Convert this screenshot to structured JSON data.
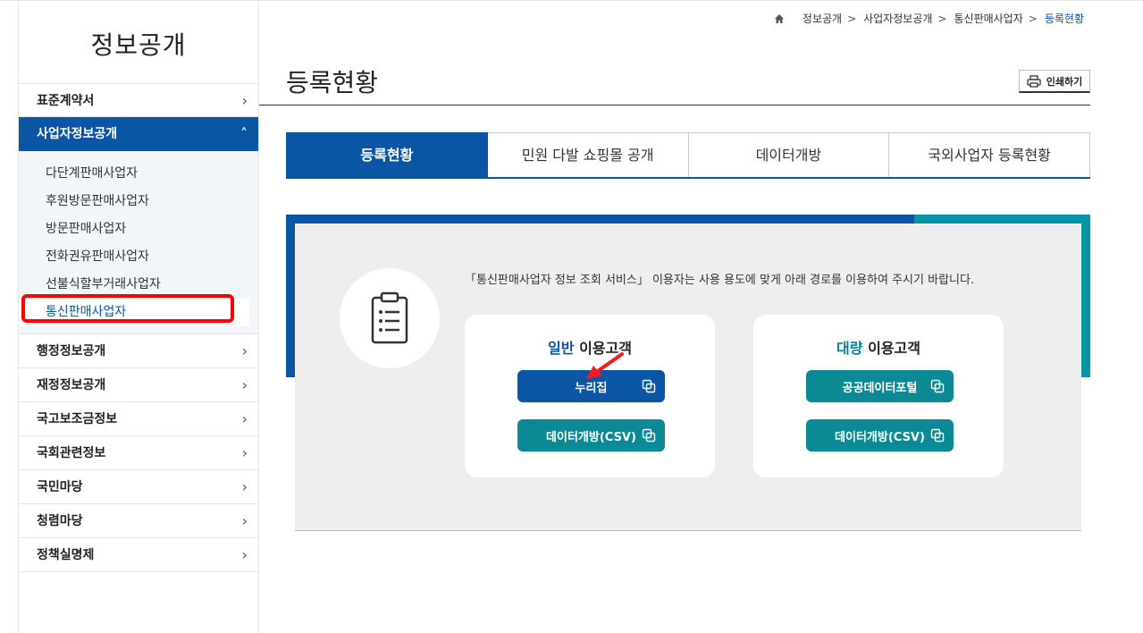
{
  "sidebar": {
    "title": "정보공개",
    "menu_top": {
      "label": "표준계약서"
    },
    "active_menu": {
      "label": "사업자정보공개"
    },
    "submenu": [
      "다단계판매사업자",
      "후원방문판매사업자",
      "방문판매사업자",
      "전화권유판매사업자",
      "선불식할부거래사업자",
      "통신판매사업자"
    ],
    "menu_bottom": [
      "행정정보공개",
      "재정정보공개",
      "국고보조금정보",
      "국회관련정보",
      "국민마당",
      "청렴마당",
      "정책실명제"
    ]
  },
  "breadcrumb": [
    "정보공개",
    "사업자정보공개",
    "통신판매사업자",
    "등록현황"
  ],
  "breadcrumb_sep": ">",
  "page_title": "등록현황",
  "print_label": "인쇄하기",
  "tabs": [
    "등록현황",
    "민원 다발 쇼핑몰 공개",
    "데이터개방",
    "국외사업자 등록현황"
  ],
  "panel": {
    "intro": "「통신판매사업자 정보 조회 서비스」 이용자는 사용 용도에 맞게 아래 경로를 이용하여 주시기 바랍니다.",
    "general": {
      "accent": "일반",
      "rest": " 이용고객",
      "btn1": "누리집",
      "btn2": "데이터개방(CSV)"
    },
    "bulk": {
      "accent": "대량",
      "rest": " 이용고객",
      "btn1": "공공데이터포털",
      "btn2": "데이터개방(CSV)"
    }
  },
  "colors": {
    "primary_blue": "#0a56a4",
    "teal": "#0894a7",
    "teal_button": "#0b8a96",
    "highlight": "#ff0000"
  },
  "icons": {
    "home": "home-icon",
    "print": "printer-icon",
    "clipboard": "clipboard-icon",
    "copy": "copy-icon",
    "chevron": "chevron-icon"
  }
}
